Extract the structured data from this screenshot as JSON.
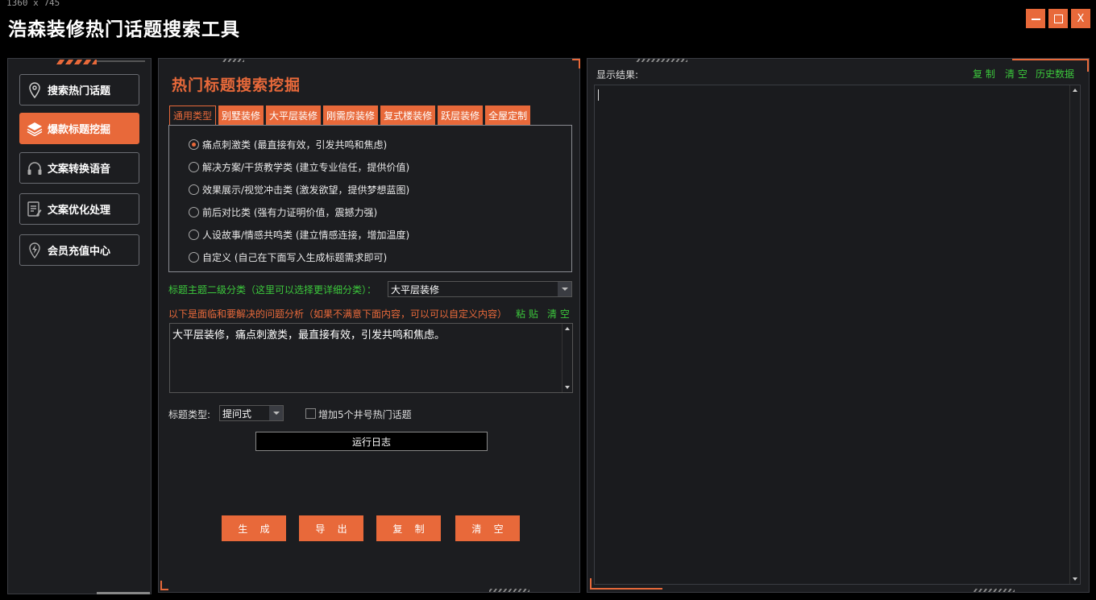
{
  "screen_dims": "1360 x 745",
  "app_title": "浩森装修热门话题搜索工具",
  "window_controls": {
    "minimize": "—",
    "maximize": "☐",
    "close": "X"
  },
  "sidebar": {
    "items": [
      {
        "label": "搜索热门话题",
        "icon": "map-pin-icon",
        "active": false
      },
      {
        "label": "爆款标题挖掘",
        "icon": "layers-icon",
        "active": true
      },
      {
        "label": "文案转换语音",
        "icon": "headphones-icon",
        "active": false
      },
      {
        "label": "文案优化处理",
        "icon": "document-edit-icon",
        "active": false
      },
      {
        "label": "会员充值中心",
        "icon": "bolt-icon",
        "active": false
      }
    ]
  },
  "main": {
    "title": "热门标题搜索挖掘",
    "tabs": [
      "通用类型",
      "别墅装修",
      "大平层装修",
      "刚需房装修",
      "复式楼装修",
      "跃层装修",
      "全屋定制"
    ],
    "active_tab": 0,
    "radio_options": [
      "痛点刺激类 (最直接有效，引发共鸣和焦虑)",
      "解决方案/干货教学类 (建立专业信任，提供价值)",
      "效果展示/视觉冲击类 (激发欲望，提供梦想蓝图)",
      "前后对比类 (强有力证明价值，震撼力强)",
      "人设故事/情感共鸣类 (建立情感连接，增加温度)",
      "自定义 (自己在下面写入生成标题需求即可)"
    ],
    "selected_radio": 0,
    "subcategory_label": "标题主题二级分类（这里可以选择更详细分类）：",
    "subcategory_value": "大平层装修",
    "analysis_label": "以下是面临和要解决的问题分析（如果不满意下面内容，可以可以自定义内容）",
    "paste_label": "粘 贴",
    "clear_label": "清 空",
    "analysis_text": "大平层装修，痛点刺激类，最直接有效，引发共鸣和焦虑。",
    "title_type_label": "标题类型:",
    "title_type_value": "提问式",
    "hashtag_label": "增加5个井号热门话题",
    "log_label": "运行日志",
    "buttons": {
      "generate": "生 成",
      "export": "导 出",
      "copy": "复 制",
      "clear": "清 空"
    }
  },
  "result": {
    "label": "显示结果:",
    "copy": "复 制",
    "clear": "清 空",
    "history": "历史数据",
    "text": ""
  },
  "colors": {
    "accent": "#e8693a",
    "green": "#3cc83c",
    "panel": "#1c1d20",
    "background": "#000000"
  }
}
